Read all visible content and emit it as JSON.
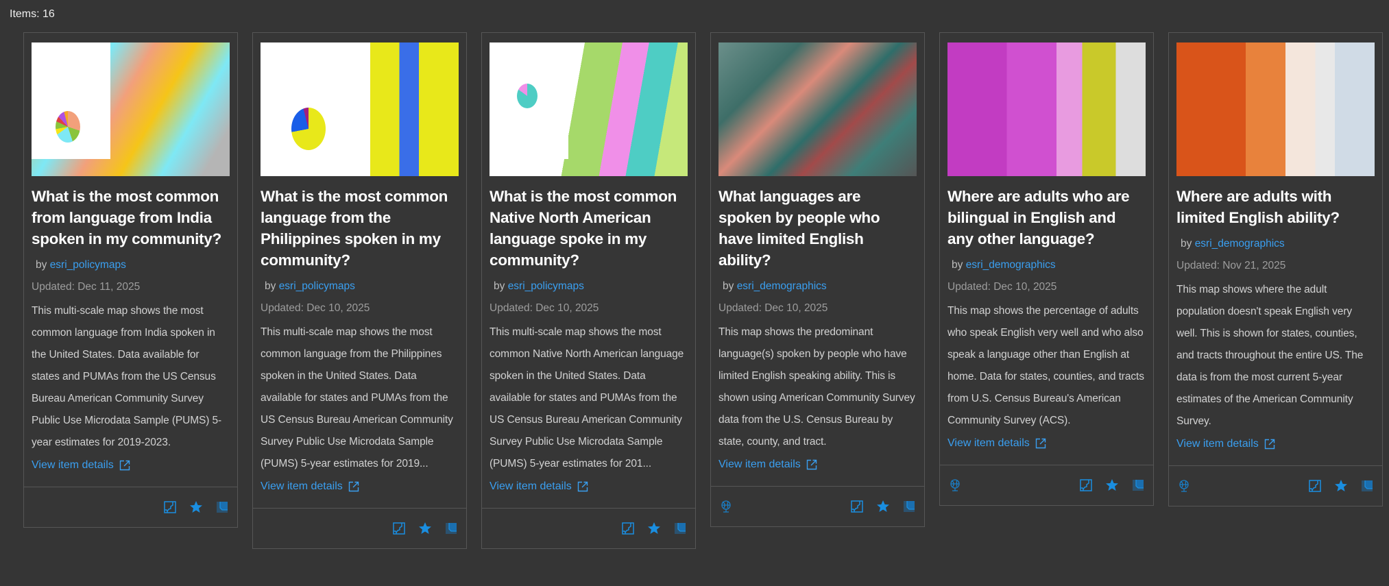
{
  "header": {
    "items_count": "Items: 16"
  },
  "colors": {
    "link": "#3a9ff0",
    "icon": "#1a8ee0",
    "background": "#353535"
  },
  "common": {
    "by": "by",
    "view_label": "View item details"
  },
  "cards": [
    {
      "title": "What is the most common from language from India spoken in my community?",
      "author": "esri_policymaps",
      "updated": "Updated: Dec 11, 2025",
      "description": "This multi-scale map shows the most common language from India spoken in the United States. Data available for states and PUMAs from the US Census Bureau American Community Survey Public Use Microdata Sample (PUMS) 5-year estimates for 2019-2023.",
      "footer_icons": [
        "map-viewer-icon",
        "favorite-star-icon",
        "scene-icon"
      ]
    },
    {
      "title": "What is the most common language from the Philippines spoken in my community?",
      "author": "esri_policymaps",
      "updated": "Updated: Dec 10, 2025",
      "description": "This multi-scale map shows the most common language from the Philippines spoken in the United States. Data available for states and PUMAs from the US Census Bureau American Community Survey Public Use Microdata Sample (PUMS) 5-year estimates for 2019...",
      "footer_icons": [
        "map-viewer-icon",
        "favorite-star-icon",
        "scene-icon"
      ]
    },
    {
      "title": "What is the most common Native North American language spoke in my community?",
      "author": "esri_policymaps",
      "updated": "Updated: Dec 10, 2025",
      "description": "This multi-scale map shows the most common Native North American language spoken in the United States. Data available for states and PUMAs from the US Census Bureau American Community Survey Public Use Microdata Sample (PUMS) 5-year estimates for 201...",
      "footer_icons": [
        "map-viewer-icon",
        "favorite-star-icon",
        "scene-icon"
      ]
    },
    {
      "title": "What languages are spoken by people who have limited English ability?",
      "author": "esri_demographics",
      "updated": "Updated: Dec 10, 2025",
      "description": "This map shows the predominant language(s) spoken by people who have limited English speaking ability. This is shown using American Community Survey data from the U.S. Census Bureau by state, county, and tract.",
      "footer_icons": [
        "globe-icon",
        "map-viewer-icon",
        "favorite-star-icon",
        "scene-icon"
      ]
    },
    {
      "title": "Where are adults who are bilingual in English and any other language?",
      "author": "esri_demographics",
      "updated": "Updated: Dec 10, 2025",
      "description": "This map shows the percentage of adults who speak English very well and who also speak a language other than English at home. Data for states, counties, and tracts from U.S. Census Bureau's American Community Survey (ACS).",
      "footer_icons": [
        "globe-icon",
        "map-viewer-icon",
        "favorite-star-icon",
        "scene-icon"
      ]
    },
    {
      "title": "Where are adults with limited English ability?",
      "author": "esri_demographics",
      "updated": "Updated: Nov 21, 2025",
      "description": "This map shows where the adult population doesn't speak English very well. This is shown for states, counties, and tracts throughout the entire US. The data is from the most current 5-year estimates of the American Community Survey.",
      "footer_icons": [
        "globe-icon",
        "map-viewer-icon",
        "favorite-star-icon",
        "scene-icon"
      ]
    }
  ]
}
